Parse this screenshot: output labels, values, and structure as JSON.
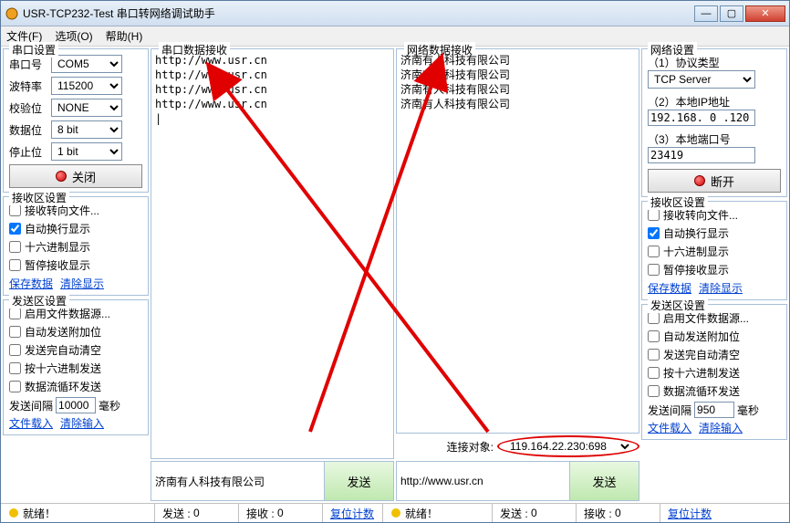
{
  "title": "USR-TCP232-Test 串口转网络调试助手",
  "menu": {
    "file": "文件(F)",
    "options": "选项(O)",
    "help": "帮助(H)"
  },
  "serial": {
    "group": "串口设置",
    "port_label": "串口号",
    "port": "COM5",
    "baud_label": "波特率",
    "baud": "115200",
    "parity_label": "校验位",
    "parity": "NONE",
    "data_label": "数据位",
    "data": "8 bit",
    "stop_label": "停止位",
    "stop": "1 bit",
    "close_btn": "关闭"
  },
  "net": {
    "group": "网络设置",
    "proto_label": "（1）协议类型",
    "proto": "TCP Server",
    "ip_label": "（2）本地IP地址",
    "ip": "192.168. 0 .120",
    "port_label": "（3）本地端口号",
    "port": "23419",
    "disconnect_btn": "断开"
  },
  "rx_opts": {
    "group": "接收区设置",
    "to_file": "接收转向文件...",
    "auto_wrap": "自动换行显示",
    "hex": "十六进制显示",
    "pause": "暂停接收显示",
    "save": "保存数据",
    "clear": "清除显示"
  },
  "tx_opts": {
    "group": "发送区设置",
    "from_file": "启用文件数据源...",
    "auto_extra": "自动发送附加位",
    "auto_clear": "发送完自动清空",
    "hex": "按十六进制发送",
    "loop": "数据流循环发送",
    "interval_label": "发送间隔",
    "interval_left": "10000",
    "interval_right": "950",
    "ms": "毫秒",
    "load": "文件载入",
    "clear": "清除输入"
  },
  "serial_rx": {
    "title": "串口数据接收",
    "content": "http://www.usr.cn\nhttp://www.usr.cn\nhttp://www.usr.cn\nhttp://www.usr.cn\n|"
  },
  "net_rx": {
    "title": "网络数据接收",
    "content": "济南有人科技有限公司\n济南有人科技有限公司\n济南有人科技有限公司\n济南有人科技有限公司"
  },
  "conn": {
    "label": "连接对象:",
    "value": "119.164.22.230:698"
  },
  "serial_tx": "济南有人科技有限公司",
  "net_tx": "http://www.usr.cn",
  "send": "发送",
  "status": {
    "ready": "就绪！",
    "sent_label": "发送 :",
    "sent": "0",
    "recv_label": "接收 :",
    "recv": "0",
    "reset": "复位计数"
  }
}
